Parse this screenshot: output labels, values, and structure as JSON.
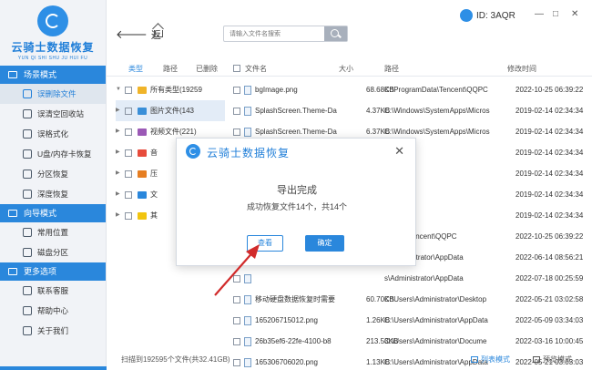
{
  "brand": {
    "name": "云骑士数据恢复",
    "sub": "YUN QI SHI SHU JU HUI FU"
  },
  "user": {
    "id": "ID: 3AQR"
  },
  "window": {
    "min": "—",
    "restore": "□",
    "close": "✕"
  },
  "sidebar": {
    "sections": [
      {
        "title": "场景模式",
        "items": [
          "误删除文件",
          "误清空回收站",
          "误格式化",
          "U盘/内存卡恢复",
          "分区恢复",
          "深度恢复"
        ]
      },
      {
        "title": "向导模式",
        "items": [
          "常用位置",
          "磁盘分区"
        ]
      },
      {
        "title": "更多选项",
        "items": [
          "联系客服",
          "帮助中心",
          "关于我们"
        ]
      }
    ]
  },
  "toolbar": {
    "back": "返",
    "search_placeholder": "请输入文件名搜索"
  },
  "table": {
    "tabs": [
      "类型",
      "路径",
      "已删除"
    ],
    "headers": {
      "name": "文件名",
      "size": "大小",
      "path": "路径",
      "date": "修改时间"
    },
    "tree": [
      {
        "label": "所有类型(19259",
        "color": "#f0b429"
      },
      {
        "label": "图片文件(143",
        "color": "#3a8fd8"
      },
      {
        "label": "视频文件(221)",
        "color": "#9b59b6"
      },
      {
        "label": "音",
        "color": "#e74c3c"
      },
      {
        "label": "压",
        "color": "#e67e22"
      },
      {
        "label": "文",
        "color": "#2a87dc"
      },
      {
        "label": "其",
        "color": "#f1c40f"
      }
    ],
    "rows": [
      {
        "name": "bgImage.png",
        "size": "68.68KB",
        "path": "C:\\ProgramData\\Tencent\\QQPC",
        "date": "2022-10-25 06:39:22"
      },
      {
        "name": "SplashScreen.Theme-Da",
        "size": "4.37KB",
        "path": "C:\\Windows\\SystemApps\\Micros",
        "date": "2019-02-14 02:34:34"
      },
      {
        "name": "SplashScreen.Theme-Da",
        "size": "6.37KB",
        "path": "C:\\Windows\\SystemApps\\Micros",
        "date": "2019-02-14 02:34:34"
      },
      {
        "name": "",
        "size": "",
        "path": "",
        "date": "2019-02-14 02:34:34"
      },
      {
        "name": "",
        "size": "",
        "path": "",
        "date": "2019-02-14 02:34:34"
      },
      {
        "name": "",
        "size": "",
        "path": "",
        "date": "2019-02-14 02:34:34"
      },
      {
        "name": "",
        "size": "",
        "path": "",
        "date": "2019-02-14 02:34:34"
      },
      {
        "name": "",
        "size": "",
        "path": "mData\\Tencent\\QQPC",
        "date": "2022-10-25 06:39:22"
      },
      {
        "name": "",
        "size": "",
        "path": "s\\Administrator\\AppData",
        "date": "2022-06-14 08:56:21"
      },
      {
        "name": "",
        "size": "",
        "path": "s\\Administrator\\AppData",
        "date": "2022-07-18 00:25:59"
      },
      {
        "name": "移动硬盘数据恢复时需要",
        "size": "60.70KB",
        "path": "C:\\Users\\Administrator\\Desktop",
        "date": "2022-05-21 03:02:58"
      },
      {
        "name": "165206715012.png",
        "size": "1.26KB",
        "path": "C:\\Users\\Administrator\\AppData",
        "date": "2022-05-09 03:34:03"
      },
      {
        "name": "26b35ef6-22fe-4100-b8",
        "size": "213.53KB",
        "path": "C:\\Users\\Administrator\\Docume",
        "date": "2022-03-16 10:00:45"
      },
      {
        "name": "165306706020.png",
        "size": "1.13KB",
        "path": "C:\\Users\\Administrator\\AppData",
        "date": "2022-05-21 03:03:03"
      }
    ]
  },
  "footer": {
    "scan": "扫描到192595个文件(共32.41GB)",
    "list_mode": "列表模式",
    "preview_mode": "预览模式"
  },
  "dialog": {
    "title": "云骑士数据恢复",
    "close": "✕",
    "message": "导出完成",
    "detail": "成功恢复文件14个，共14个",
    "view_button": "查看",
    "ok_button": "确定"
  },
  "colors": {
    "accent": "#2a87dc",
    "annotation": "#d12b2b"
  },
  "icons": {
    "back": "arrow-left-icon",
    "home": "home-icon",
    "search": "search-icon"
  }
}
